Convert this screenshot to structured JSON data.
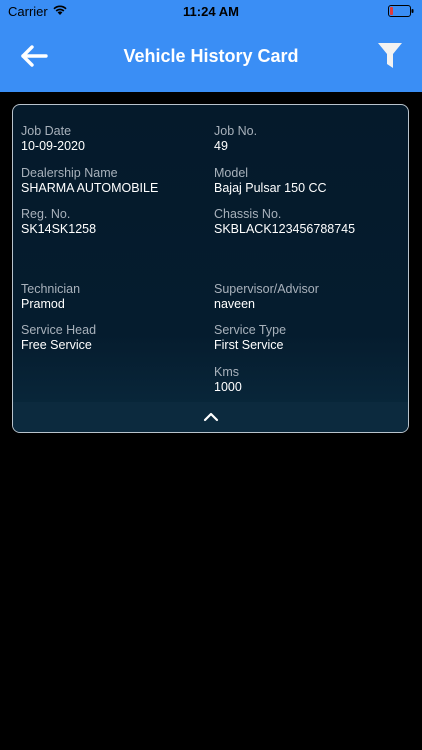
{
  "status_bar": {
    "carrier": "Carrier",
    "time": "11:24 AM"
  },
  "nav": {
    "title": "Vehicle History Card",
    "back_icon": "arrow-left-icon",
    "filter_icon": "filter-icon"
  },
  "card": {
    "fields": [
      {
        "label": "Job Date",
        "value": "10-09-2020"
      },
      {
        "label": "Job No.",
        "value": "49"
      },
      {
        "label": "Dealership Name",
        "value": "SHARMA AUTOMOBILE"
      },
      {
        "label": "Model",
        "value": "Bajaj Pulsar 150 CC"
      },
      {
        "label": "Reg. No.",
        "value": "SK14SK1258"
      },
      {
        "label": "Chassis No.",
        "value": "SKBLACK123456788745"
      },
      {
        "label": "Technician",
        "value": "Pramod"
      },
      {
        "label": "Supervisor/Advisor",
        "value": "naveen"
      },
      {
        "label": "Service Head",
        "value": "Free Service"
      },
      {
        "label": "Service Type",
        "value": "First Service"
      },
      {
        "label": "Kms",
        "value": "1000"
      }
    ],
    "collapse_icon": "chevron-up-icon"
  },
  "colors": {
    "accent": "#3a8ef5",
    "card_bg": "#051a2b",
    "battery_low": "#e03a3a"
  }
}
